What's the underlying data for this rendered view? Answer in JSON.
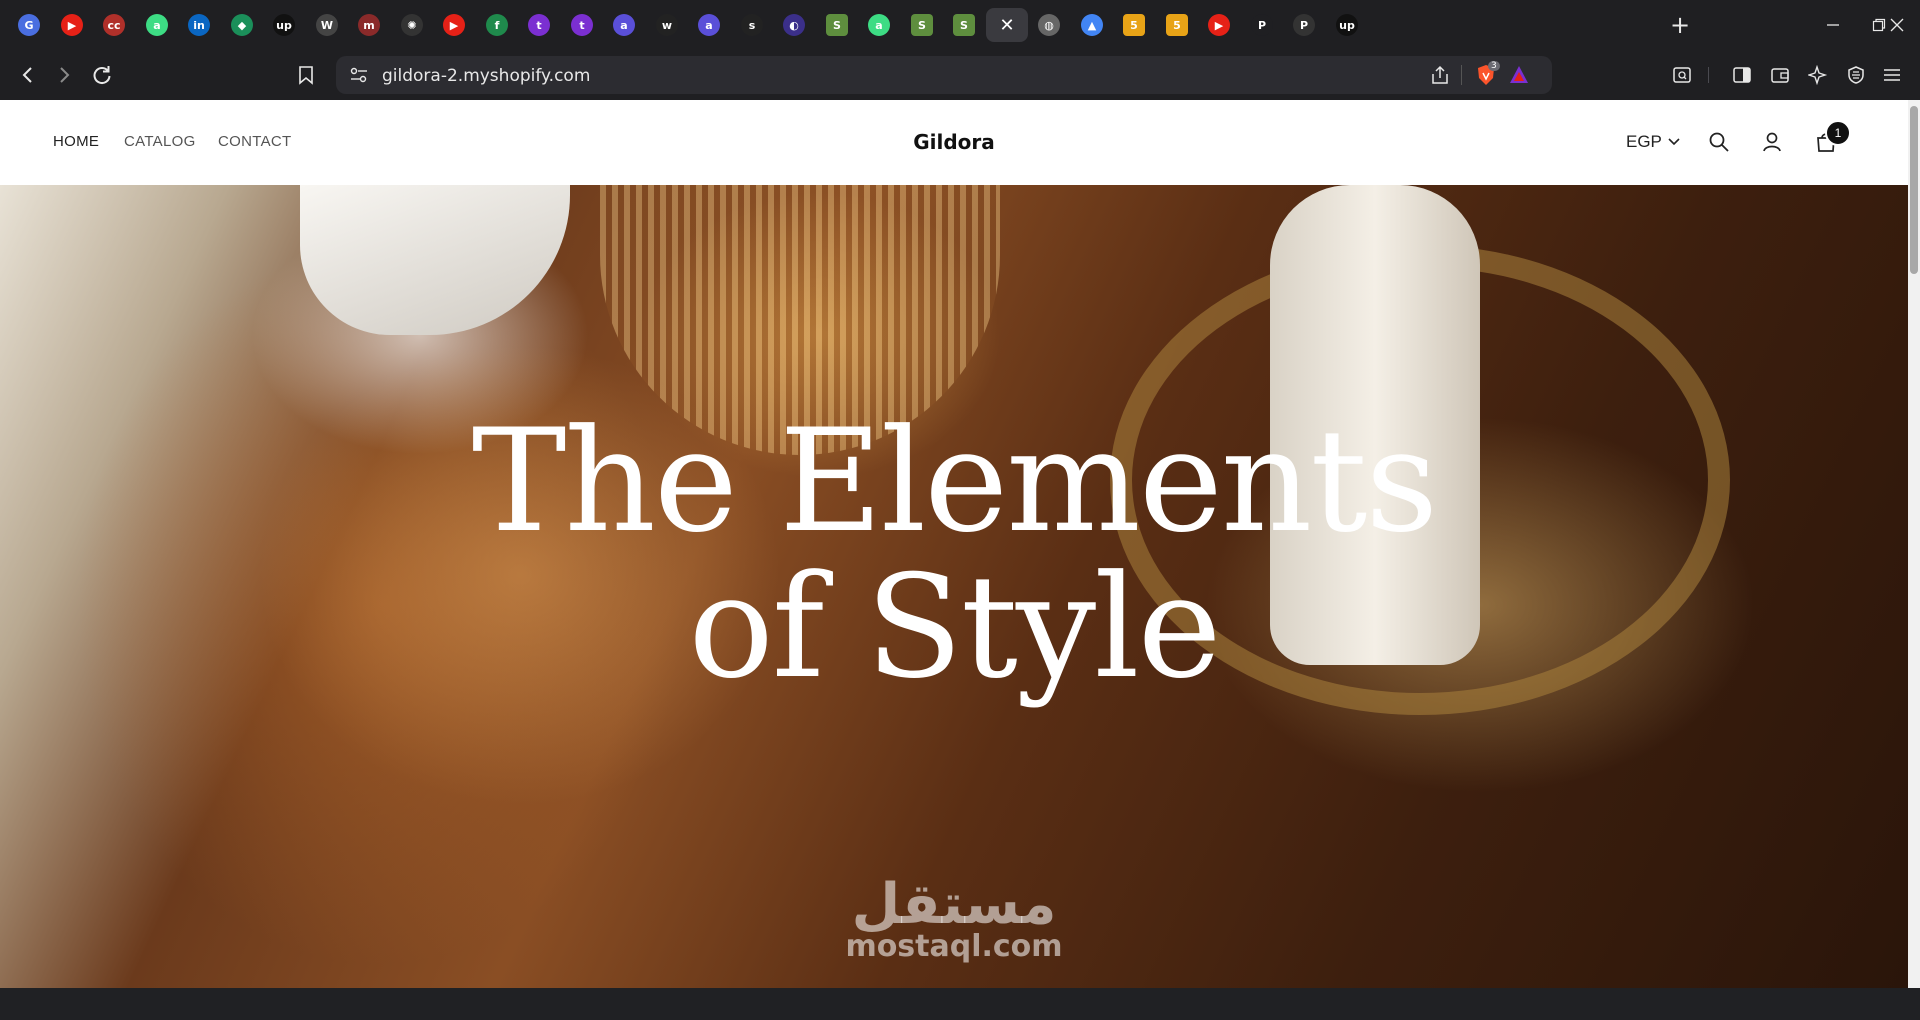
{
  "browser": {
    "tabs": [
      {
        "icon": "google-translate-icon",
        "color": "#4a6ee0",
        "glyph": "G"
      },
      {
        "icon": "youtube-icon",
        "color": "#e62117",
        "glyph": "▶"
      },
      {
        "icon": "ccc-icon",
        "color": "#b0302a",
        "glyph": "cc"
      },
      {
        "icon": "android-icon",
        "color": "#3ddc84",
        "glyph": "a"
      },
      {
        "icon": "linkedin-icon",
        "color": "#0a66c2",
        "glyph": "in"
      },
      {
        "icon": "diamond-icon",
        "color": "#1b8f5a",
        "glyph": "◆"
      },
      {
        "icon": "upwork-icon",
        "color": "#111111",
        "glyph": "up"
      },
      {
        "icon": "wordpress-icon",
        "color": "#444444",
        "glyph": "W"
      },
      {
        "icon": "mostaql-icon",
        "color": "#8a2a2a",
        "glyph": "m"
      },
      {
        "icon": "chatgpt-icon",
        "color": "#333333",
        "glyph": "✺"
      },
      {
        "icon": "youtube-icon",
        "color": "#e62117",
        "glyph": "▶"
      },
      {
        "icon": "f-icon",
        "color": "#1f8a4c",
        "glyph": "f"
      },
      {
        "icon": "t-icon",
        "color": "#7b2fd1",
        "glyph": "t"
      },
      {
        "icon": "t-icon",
        "color": "#7b2fd1",
        "glyph": "t"
      },
      {
        "icon": "a-circle-icon",
        "color": "#5a4fd8",
        "glyph": "a"
      },
      {
        "icon": "wix-icon",
        "color": "#222222",
        "glyph": "w"
      },
      {
        "icon": "a-circle-icon",
        "color": "#5a4fd8",
        "glyph": "a"
      },
      {
        "icon": "s-icon",
        "color": "#222222",
        "glyph": "s"
      },
      {
        "icon": "circle-icon",
        "color": "#3b2f8a",
        "glyph": "◐"
      },
      {
        "icon": "shopify-icon",
        "color": "#5e8e3e",
        "glyph": "S"
      },
      {
        "icon": "android-icon",
        "color": "#3ddc84",
        "glyph": "a"
      },
      {
        "icon": "shopify-icon",
        "color": "#5e8e3e",
        "glyph": "S"
      },
      {
        "icon": "shopify-icon",
        "color": "#5e8e3e",
        "glyph": "S"
      },
      {
        "icon": "close-icon",
        "active": true,
        "glyph": "✕"
      },
      {
        "icon": "globe-icon",
        "color": "#666666",
        "glyph": "◍"
      },
      {
        "icon": "ads-icon",
        "color": "#4285f4",
        "glyph": "▲"
      },
      {
        "icon": "five-icon",
        "color": "#e8a317",
        "glyph": "5"
      },
      {
        "icon": "five-icon",
        "color": "#e8a317",
        "glyph": "5"
      },
      {
        "icon": "youtube-icon",
        "color": "#e62117",
        "glyph": "▶"
      },
      {
        "icon": "p-icon",
        "color": "#1f1f22",
        "glyph": "P"
      },
      {
        "icon": "p-icon",
        "color": "#333333",
        "glyph": "P"
      },
      {
        "icon": "upwork-icon",
        "color": "#111111",
        "glyph": "up"
      }
    ],
    "url": "gildora-2.myshopify.com",
    "brave_badge": "3"
  },
  "header": {
    "nav": [
      "HOME",
      "CATALOG",
      "CONTACT"
    ],
    "logo": "Gildora",
    "currency": "EGP",
    "cart_count": "1"
  },
  "hero": {
    "title_line1": "The Elements",
    "title_line2": "of Style"
  },
  "watermark": {
    "arabic": "مستقل",
    "latin": "mostaql.com"
  }
}
